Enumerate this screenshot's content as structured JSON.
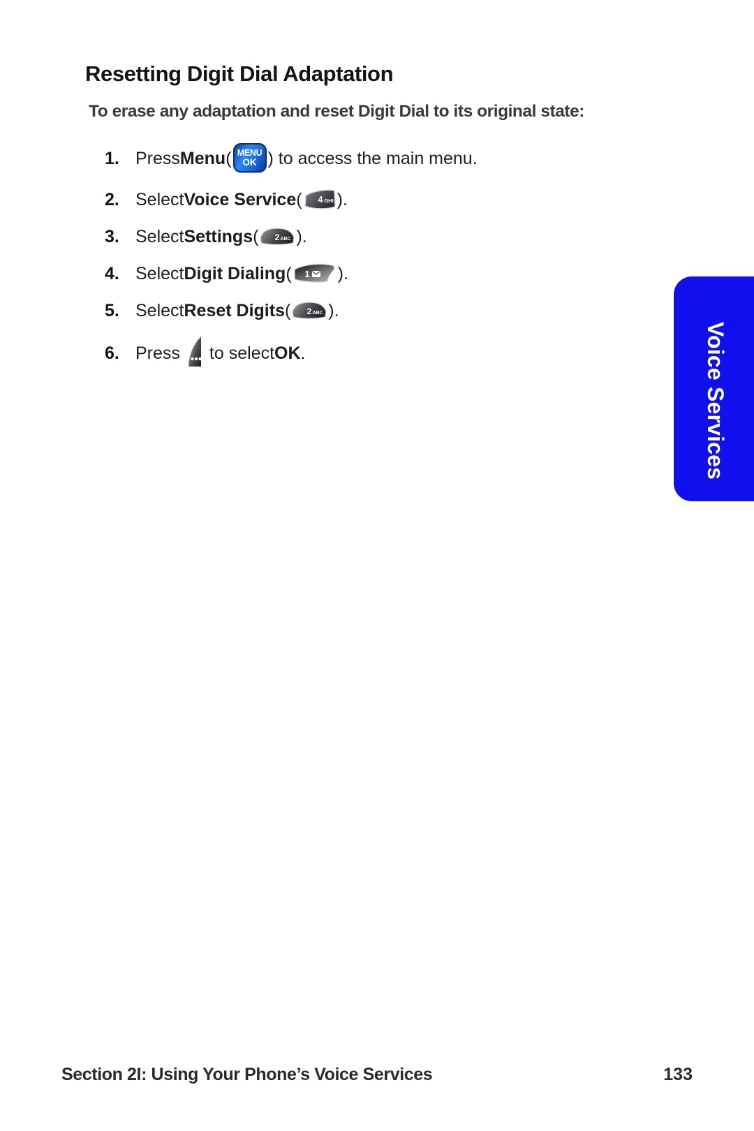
{
  "page": {
    "heading": "Resetting Digit Dial Adaptation",
    "subheading": "To erase any adaptation and reset Digit Dial to its original state:"
  },
  "steps": [
    {
      "number": "1.",
      "lead": "Press ",
      "bold": "Menu",
      "after_bold": " (",
      "key": "menu-ok-key",
      "key_line1": "MENU",
      "key_line2": "OK",
      "tail": ") to access the main menu."
    },
    {
      "number": "2.",
      "lead": "Select ",
      "bold": "Voice Service",
      "after_bold": " (",
      "key": "number-key-4-ghi",
      "key_digit": "4",
      "key_letters": "GHI",
      "tail": ")."
    },
    {
      "number": "3.",
      "lead": "Select ",
      "bold": "Settings",
      "after_bold": " (",
      "key": "number-key-2-abc",
      "key_digit": "2",
      "key_letters": "ABC",
      "tail": ")."
    },
    {
      "number": "4.",
      "lead": "Select ",
      "bold": "Digit Dialing",
      "after_bold": " (",
      "key": "number-key-1-voicemail",
      "key_digit": "1",
      "key_letters": "envelope-icon",
      "tail": ")."
    },
    {
      "number": "5.",
      "lead": "Select ",
      "bold": "Reset Digits",
      "after_bold": " (",
      "key": "number-key-2-abc",
      "key_digit": "2",
      "key_letters": "ABC",
      "tail": ")."
    },
    {
      "number": "6.",
      "lead": "Press ",
      "key": "left-softkey-ellipsis",
      "mid": " to select ",
      "bold": "OK",
      "tail": "."
    }
  ],
  "side_tab": {
    "label": "Voice Services",
    "color": "#1010ee"
  },
  "footer": {
    "section": "Section 2I: Using Your Phone’s Voice Services",
    "page_number": "133"
  }
}
